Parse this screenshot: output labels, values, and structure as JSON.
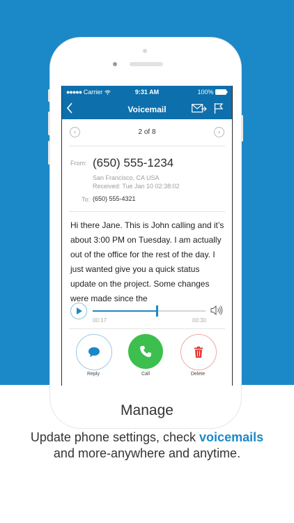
{
  "status_bar": {
    "signal": "●●●●●",
    "carrier": "Carrier",
    "time": "9:31 AM",
    "battery": "100%"
  },
  "nav": {
    "title": "Voicemail"
  },
  "pager": {
    "label": "2 of 8"
  },
  "message": {
    "from_label": "From:",
    "from_number": "(650) 555-1234",
    "location": "San Francisco, CA USA",
    "received": "Received: Tue Jan 10 02:38:02",
    "to_label": "To:",
    "to_number": "(650) 555-4321",
    "transcript": "Hi there Jane. This is John calling and it’s about 3:00 PM on Tuesday. I am actually out of the office for the rest of the day. I just wanted give you a quick status update on the project. Some changes were made since the"
  },
  "player": {
    "elapsed": "00:17",
    "duration": "00:30",
    "progress": 0.57
  },
  "actions": {
    "reply": "Reply",
    "call": "Call",
    "delete": "Delete"
  },
  "caption": {
    "heading": "Manage",
    "line1_prefix": "Update phone settings, check",
    "line1_highlight": "voicemails",
    "line2": "and more-anywhere and anytime."
  },
  "colors": {
    "brand_blue": "#1b88c8",
    "call_green": "#3cbf4e",
    "delete_red": "#e53935"
  }
}
